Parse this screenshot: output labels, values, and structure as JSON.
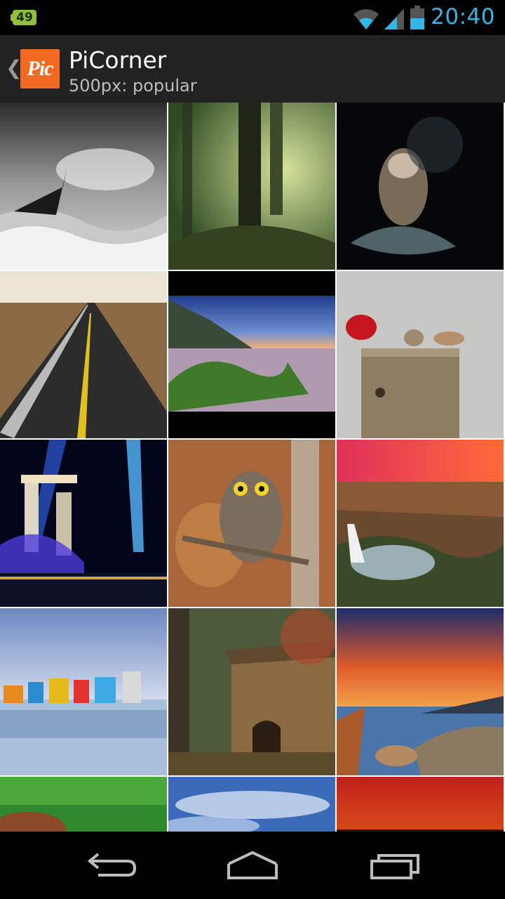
{
  "status_bar": {
    "notification_count": "49",
    "time": "20:40"
  },
  "action_bar": {
    "logo_text": "Pic",
    "title": "PiCorner",
    "subtitle": "500px: popular"
  },
  "photos": [
    "Ship in stormy sea (black and white)",
    "Misty forest path",
    "Otter splashing in water",
    "Desert highway",
    "Mossy rocks on beach at sunset",
    "Cardinal birds on wooden post",
    "Marina Bay Sands light show",
    "Owl perched on branch",
    "Canyon waterfall at sunset",
    "Colorful houses reflected in water",
    "Old house in autumn forest",
    "Coastal sunset with rocks",
    "Green blurred photo",
    "Blue sky with clouds",
    "Orange red sunset sky"
  ],
  "icons": {
    "back": "back-arrow-icon",
    "home": "home-icon",
    "recents": "recent-apps-icon"
  }
}
